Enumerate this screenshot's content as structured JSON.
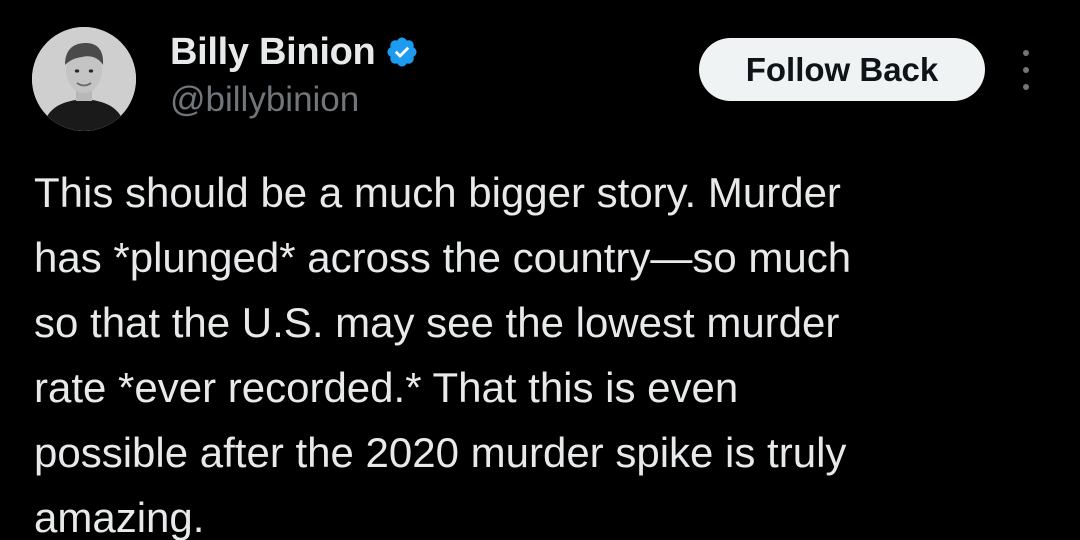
{
  "author": {
    "display_name": "Billy Binion",
    "handle": "@billybinion",
    "verified": true,
    "verified_icon": "verified-badge-icon",
    "verified_color": "#1d9bf0"
  },
  "actions": {
    "follow_label": "Follow Back",
    "more_icon": "more-vertical-icon"
  },
  "tweet": {
    "lines": [
      "This should be a much bigger story. Murder",
      "has *plunged* across the country—so much",
      "so that the U.S. may see the lowest murder",
      "rate *ever recorded.* That this is even",
      "possible after the 2020 murder spike is truly",
      "amazing."
    ]
  },
  "colors": {
    "background": "#000000",
    "text_primary": "#e7e9ea",
    "text_secondary": "#71767b",
    "button_bg": "#eff3f4",
    "button_text": "#0f1419"
  }
}
